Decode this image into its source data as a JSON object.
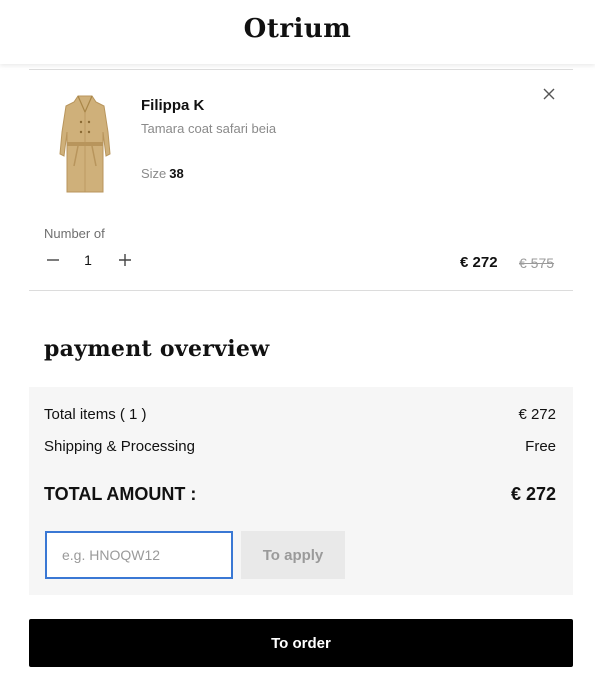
{
  "header": {
    "logo": "Otrium"
  },
  "cart_item": {
    "brand": "Filippa K",
    "product_name": "Tamara coat safari beia",
    "size_label": "Size",
    "size_value": "38",
    "image_icon": "coat-image",
    "remove_icon": "close-icon",
    "quantity_label": "Number of",
    "quantity": "1",
    "price": "€ 272",
    "original_price": "€ 575"
  },
  "payment": {
    "title": "payment overview",
    "total_items_label": "Total items ( 1 )",
    "total_items_value": "€ 272",
    "shipping_label": "Shipping & Processing",
    "shipping_value": "Free",
    "total_label": "TOTAL AMOUNT :",
    "total_value": "€ 272",
    "coupon_placeholder": "e.g. HNOQW12",
    "apply_label": "To apply"
  },
  "order_button_label": "To order",
  "colors": {
    "accent_blue": "#3a78d4",
    "button_black": "#000000",
    "panel_bg": "#f6f6f6"
  }
}
